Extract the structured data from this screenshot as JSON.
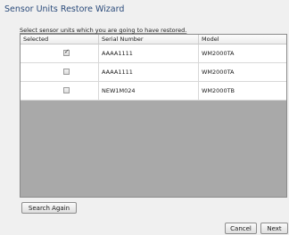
{
  "window": {
    "title": "Sensor Units Restore Wizard",
    "instruction": "Select sensor units which you are going to have restored."
  },
  "table": {
    "columns": [
      "Selected",
      "Serial Number",
      "Model"
    ],
    "rows": [
      {
        "selected": true,
        "serial": "AAAA1111",
        "model": "WM2000TA"
      },
      {
        "selected": false,
        "serial": "AAAA1111",
        "model": "WM2000TA"
      },
      {
        "selected": false,
        "serial": "NEW1M024",
        "model": "WM2000TB"
      }
    ]
  },
  "buttons": {
    "search_again": "Search Again",
    "cancel": "Cancel",
    "next": "Next"
  },
  "check_glyph": "✓"
}
